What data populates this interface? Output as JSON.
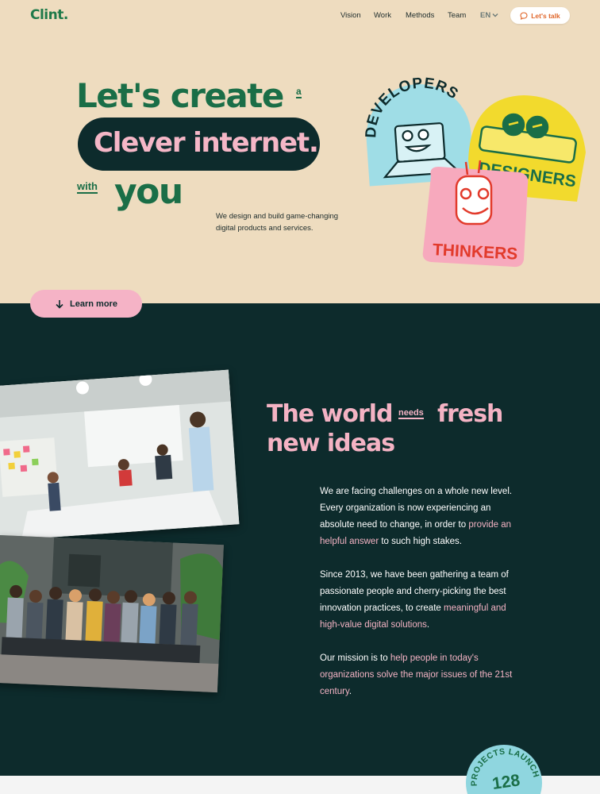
{
  "header": {
    "logo": "Clint.",
    "nav": [
      "Vision",
      "Work",
      "Methods",
      "Team"
    ],
    "lang": "EN",
    "cta": "Let's talk"
  },
  "hero": {
    "line1": "Let's create",
    "small_a": "a",
    "pill": "Clever internet.",
    "small_with": "with",
    "you": "you",
    "description": "We design and build game-changing digital products and services.",
    "stickers": [
      "DEVELOPERS",
      "DESIGNERS",
      "THINKERS"
    ],
    "learn_more": "Learn more"
  },
  "mission": {
    "title_part1": "The world",
    "title_needs": "needs",
    "title_part2": "fresh",
    "title_line2": "new ideas",
    "p1_a": "We are facing challenges on a whole new level. Every organization is now experiencing an absolute need to change, in order to ",
    "p1_pink": "provide an helpful answer",
    "p1_b": " to such high stakes.",
    "p2_a": "Since 2013, we have been gathering a team of passionate people and cherry-picking the best innovation practices, to create ",
    "p2_pink": "meaningful and high-value digital solutions",
    "p2_b": ".",
    "p3_a": "Our mission is to ",
    "p3_pink": "help people in today's organizations solve the major issues of the 21st century",
    "p3_b": "."
  },
  "badge": {
    "label": "PROJECTS LAUNCHED",
    "count": "128"
  },
  "colors": {
    "cream": "#eedcbf",
    "dark": "#0d2b2c",
    "green": "#1a6e47",
    "pink": "#f4b3c4",
    "orange": "#e0662a"
  }
}
